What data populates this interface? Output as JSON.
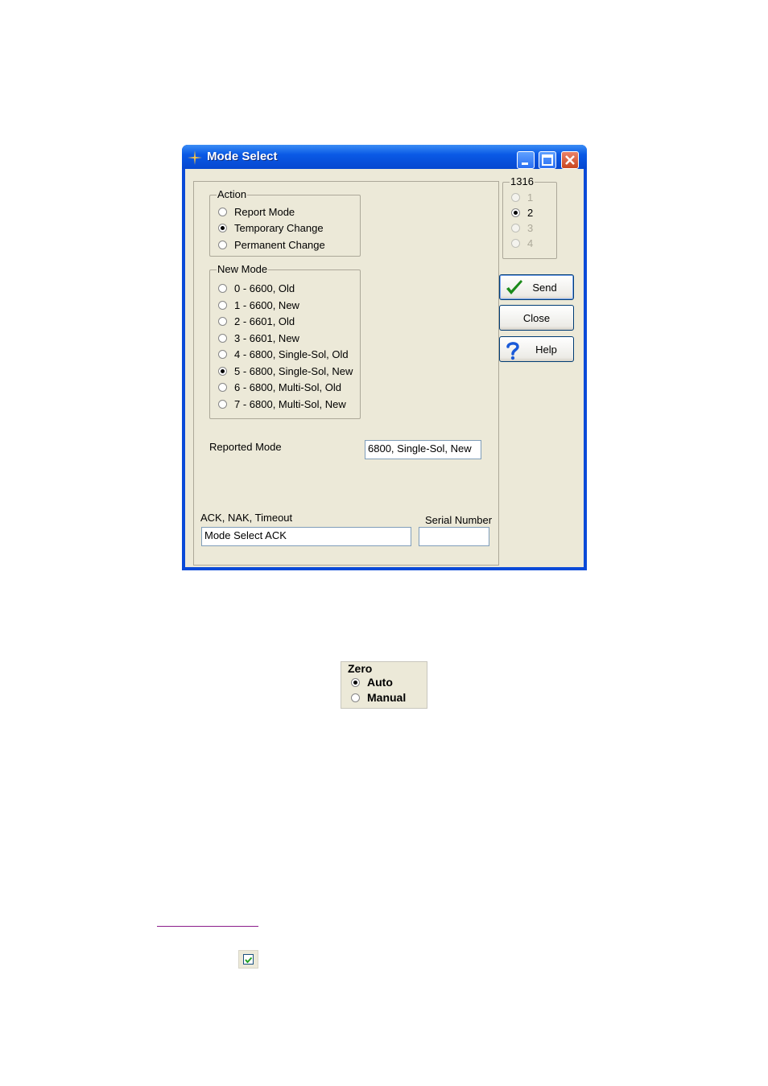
{
  "window": {
    "title": "Mode Select",
    "icons": {
      "app": "sparkle-icon",
      "minimize": "minimize-icon",
      "maximize": "maximize-icon",
      "close": "close-icon"
    }
  },
  "action": {
    "label": "Action",
    "options": [
      "Report Mode",
      "Temporary Change",
      "Permanent Change"
    ],
    "selected": "Temporary Change"
  },
  "new_mode": {
    "label": "New Mode",
    "options": [
      "0 - 6600, Old",
      "1 - 6600, New",
      "2 - 6601, Old",
      "3 - 6601, New",
      "4 - 6800, Single-Sol, Old",
      "5 - 6800, Single-Sol, New",
      "6 - 6800, Multi-Sol, Old",
      "7 - 6800, Multi-Sol, New"
    ],
    "selected": "5 - 6800, Single-Sol, New"
  },
  "reported_mode": {
    "label": "Reported Mode",
    "value": "6800, Single-Sol, New"
  },
  "ack": {
    "label": "ACK, NAK, Timeout",
    "value": "Mode Select  ACK"
  },
  "serial": {
    "label": "Serial Number",
    "value": ""
  },
  "group1316": {
    "label": "1316",
    "options": [
      "1",
      "2",
      "3",
      "4"
    ],
    "selected": "2",
    "enabled": [
      "2"
    ]
  },
  "buttons": {
    "send": "Send",
    "close": "Close",
    "help": "Help",
    "send_icon": "checkmark-icon",
    "help_icon": "question-icon"
  },
  "zero": {
    "label": "Zero",
    "options": [
      "Auto",
      "Manual"
    ],
    "selected": "Auto"
  },
  "colors": {
    "titlebar": "#0a5ae6",
    "face": "#ece9d8",
    "check": "#1a8a1a",
    "help": "#1a5ad8"
  }
}
